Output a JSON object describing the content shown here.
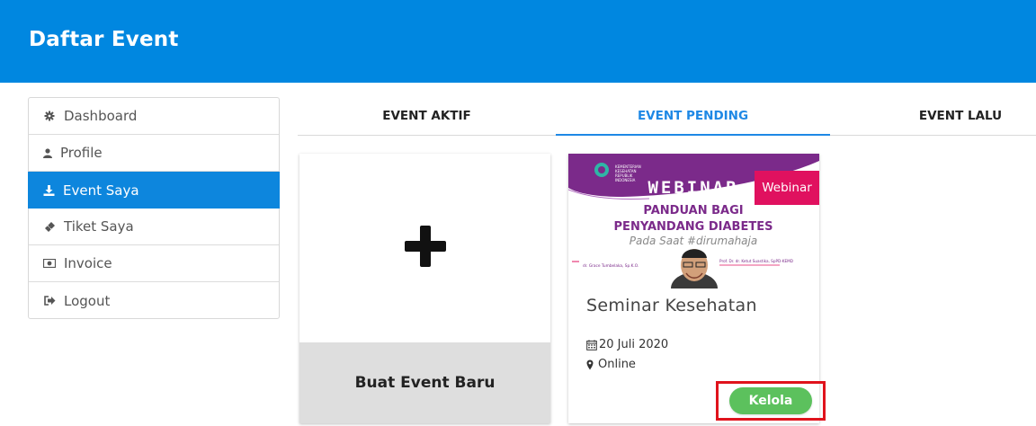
{
  "header": {
    "title": "Daftar Event"
  },
  "sidebar": {
    "items": [
      {
        "label": "Dashboard",
        "icon": "gear-icon"
      },
      {
        "label": "Profile",
        "icon": "user-icon"
      },
      {
        "label": "Event Saya",
        "icon": "download-icon",
        "active": true
      },
      {
        "label": "Tiket Saya",
        "icon": "ticket-icon"
      },
      {
        "label": "Invoice",
        "icon": "money-icon"
      },
      {
        "label": "Logout",
        "icon": "sign-out-icon"
      }
    ]
  },
  "tabs": [
    {
      "label": "EVENT AKTIF"
    },
    {
      "label": "EVENT PENDING",
      "active": true
    },
    {
      "label": "EVENT LALU"
    }
  ],
  "new_event_card": {
    "label": "Buat Event Baru",
    "icon": "plus-icon"
  },
  "event_card": {
    "badge": "Webinar",
    "title": "Seminar Kesehatan",
    "date": "20 Juli 2020",
    "location": "Online",
    "manage_label": "Kelola",
    "poster": {
      "heading": "WEBINAR",
      "line1": "PANDUAN BAGI",
      "line2": "PENYANDANG DIABETES",
      "line3": "Pada Saat #dirumahaja",
      "speaker1": "dr. Grace Tumbelaka, Sp.K.O.",
      "speaker2": "Prof. Dr. dr. Ketut Suastika, SpPD-KEMD"
    }
  },
  "colors": {
    "header": "#0087e0",
    "active": "#0d86dd",
    "badge": "#e0115f",
    "button": "#5cc15d",
    "highlight": "#e0131c",
    "poster_purple": "#7b2a8a"
  }
}
